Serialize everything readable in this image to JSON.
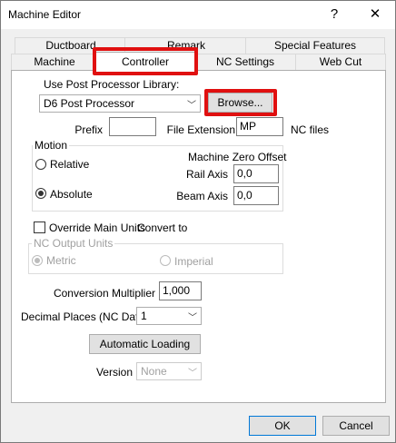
{
  "window": {
    "title": "Machine Editor",
    "help_glyph": "?",
    "close_glyph": "✕"
  },
  "tabs": {
    "row1": [
      "Ductboard",
      "Remark",
      "Special Features"
    ],
    "row2": [
      "Machine",
      "Controller",
      "NC Settings",
      "Web Cut"
    ],
    "selected": "Controller"
  },
  "controller": {
    "library_label": "Use Post Processor Library:",
    "library_value": "D6 Post Processor",
    "browse_label": "Browse...",
    "prefix_label": "Prefix",
    "prefix_value": "",
    "ext_label": "File Extension",
    "ext_value": "MP",
    "ext_suffix": "NC files",
    "motion": {
      "title": "Motion",
      "relative": "Relative",
      "absolute": "Absolute",
      "selected": "Absolute",
      "zero_offset_label": "Machine Zero Offset",
      "rail_axis_label": "Rail Axis",
      "rail_axis_value": "0,0",
      "beam_axis_label": "Beam Axis",
      "beam_axis_value": "0,0"
    },
    "override_label": "Override Main Units",
    "convert_label": "Convert to",
    "nc_units": {
      "title": "NC Output Units",
      "metric": "Metric",
      "imperial": "Imperial",
      "selected": "Metric"
    },
    "conversion_label": "Conversion Multiplier",
    "conversion_value": "1,000",
    "decimal_label": "Decimal Places (NC Data)",
    "decimal_value": "1",
    "auto_loading_label": "Automatic Loading",
    "version_label": "Version",
    "version_value": "None",
    "arrow_glyph": "﹀"
  },
  "footer": {
    "ok_label": "OK",
    "cancel_label": "Cancel"
  },
  "colors": {
    "highlight": "#e01010",
    "panel": "#ffffff",
    "chrome": "#f0f0f0",
    "focus": "#0078d7"
  }
}
